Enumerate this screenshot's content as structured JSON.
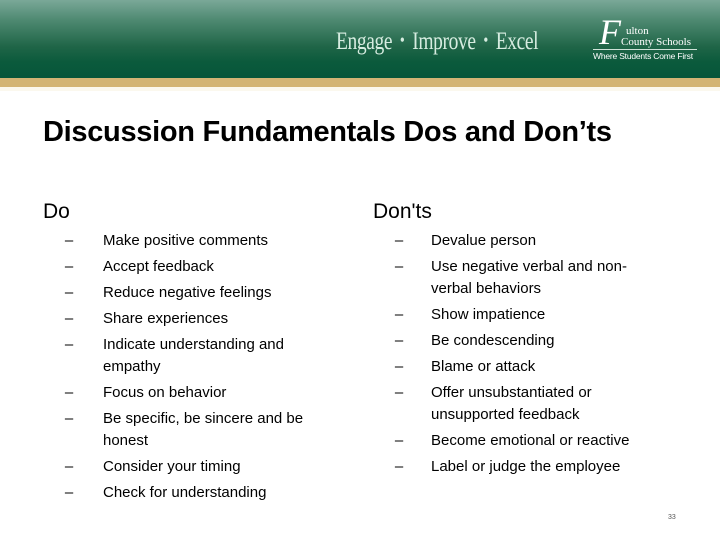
{
  "header": {
    "tagline": [
      "Engage",
      "Improve",
      "Excel"
    ],
    "tagline_separator": "•",
    "logo": {
      "initial": "F",
      "line1": "ulton",
      "line2": "County Schools",
      "motto": "Where Students Come First"
    },
    "colors": {
      "green": "#07563a",
      "gold": "#d3b474"
    }
  },
  "slide": {
    "title": "Discussion Fundamentals Dos and Don’ts",
    "do_heading": "Do",
    "dont_heading": "Don'ts",
    "bullet_glyph": "–",
    "do_items": [
      "Make positive comments",
      "Accept feedback",
      "Reduce negative feelings",
      "Share experiences",
      "Indicate understanding and empathy",
      "Focus on behavior",
      "Be specific, be sincere and be honest",
      "Consider your timing",
      "Check for understanding"
    ],
    "dont_items": [
      "Devalue person",
      "Use negative verbal and non-verbal behaviors",
      "Show impatience",
      "Be condescending",
      "Blame or attack",
      "Offer unsubstantiated or unsupported feedback",
      "Become emotional or reactive",
      "Label or judge the employee"
    ],
    "page_number": "33"
  }
}
